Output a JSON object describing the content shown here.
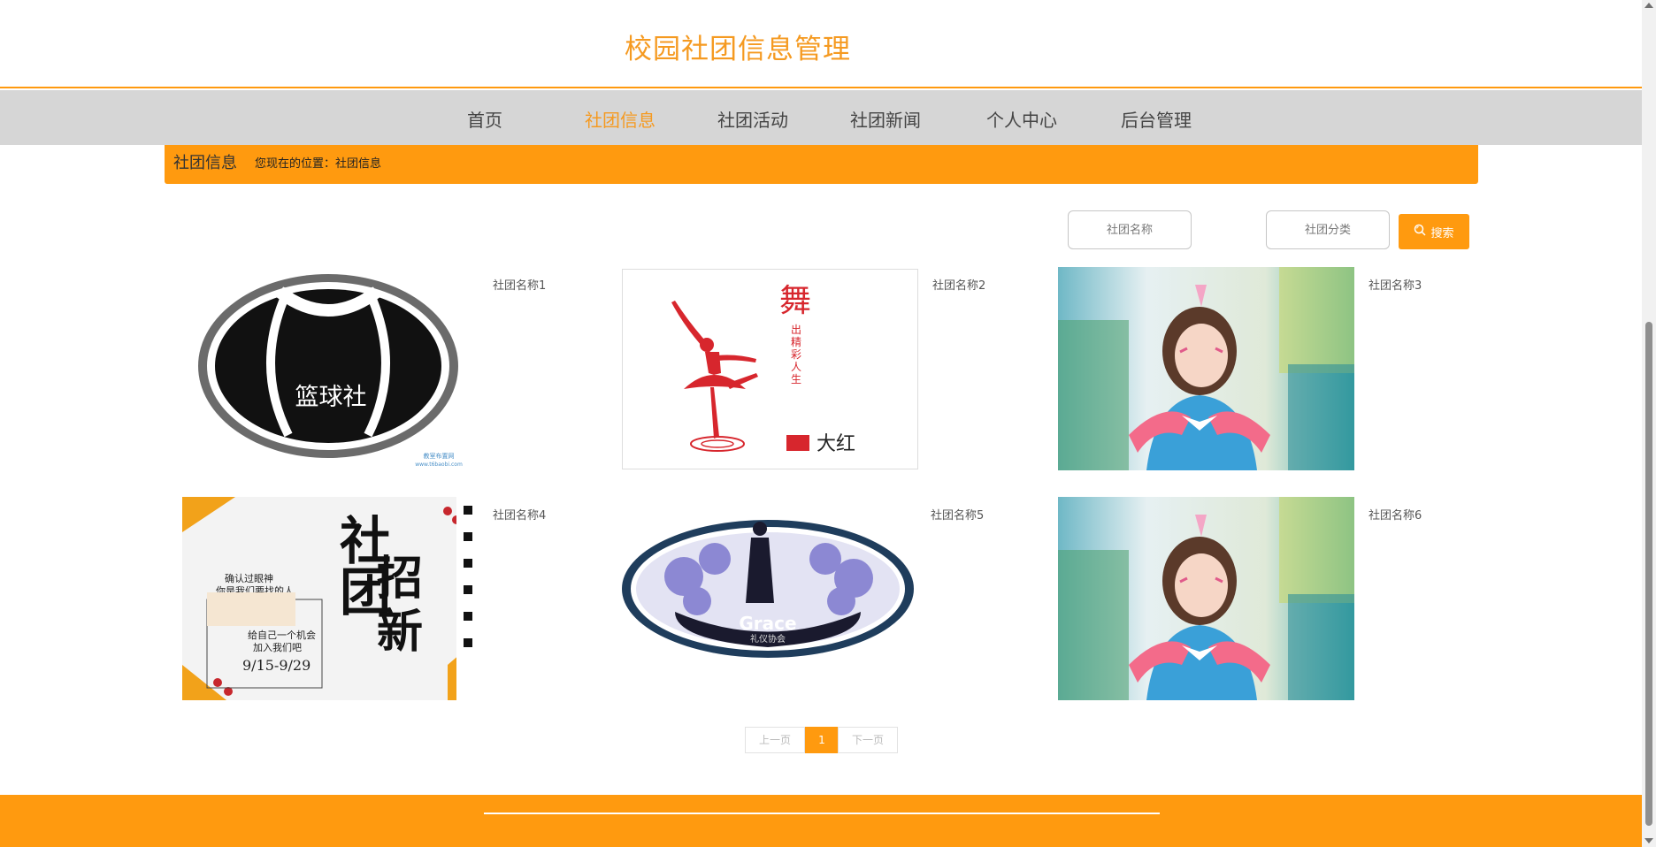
{
  "site": {
    "title": "校园社团信息管理"
  },
  "nav": {
    "items": [
      {
        "label": "首页"
      },
      {
        "label": "社团信息"
      },
      {
        "label": "社团活动"
      },
      {
        "label": "社团新闻"
      },
      {
        "label": "个人中心"
      },
      {
        "label": "后台管理"
      }
    ],
    "active": "社团信息"
  },
  "location": {
    "title": "社团信息",
    "path": "您现在的位置：社团信息"
  },
  "search": {
    "name_placeholder": "社团名称",
    "category_placeholder": "社团分类",
    "button_label": "搜索",
    "button_icon": "search-icon"
  },
  "clubs": [
    {
      "name": "社团名称1",
      "image_text": "篮球社",
      "image_watermark": "教室布置网\nwww.t6baobi.com"
    },
    {
      "name": "社团名称2",
      "image_text": "大红",
      "image_caption": "舞出精彩人生"
    },
    {
      "name": "社团名称3"
    },
    {
      "name": "社团名称4",
      "image_text": "社团招新",
      "image_lines": [
        "确认过眼神",
        "你是我们要找的人",
        "给自己一个机会",
        "加入我们吧",
        "9/15-9/29"
      ]
    },
    {
      "name": "社团名称5",
      "image_text": "Grace",
      "image_caption": "礼仪协会"
    },
    {
      "name": "社团名称6"
    }
  ],
  "pagination": {
    "prev_label": "上一页",
    "current": "1",
    "next_label": "下一页"
  },
  "colors": {
    "accent": "#ff9a0f",
    "title": "#f59a21",
    "nav_bg": "#d6d6d6"
  }
}
